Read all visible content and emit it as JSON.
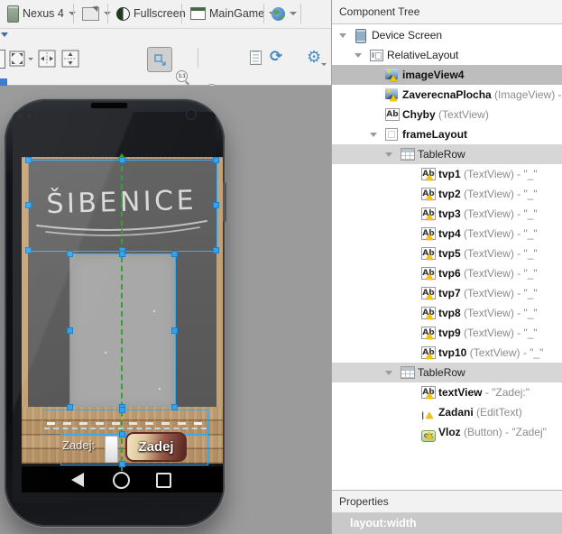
{
  "toolbar": {
    "device_selector": "Nexus 4",
    "fullscreen_label": "Fullscreen",
    "activity_selector": "MainGame",
    "zoom_actual_label": "1:1"
  },
  "icons": {
    "textview_glyph": "Ab",
    "button_glyph": "OK",
    "edittext_glyph": "I",
    "refresh_glyph": "⟳",
    "gear_glyph": "⚙"
  },
  "component_tree": {
    "title": "Component Tree",
    "rows": [
      {
        "label": "Device Screen",
        "level": 1,
        "icon": "device",
        "arrow": true
      },
      {
        "label": "RelativeLayout",
        "level": 2,
        "icon": "layout",
        "arrow": true
      },
      {
        "label": "imageView4",
        "level": 3,
        "icon": "image",
        "warn": true,
        "bold": true,
        "selected": true
      },
      {
        "label": "ZaverecnaPlocha",
        "type": "(ImageView)",
        "value": "-",
        "level": 3,
        "icon": "image",
        "warn": true,
        "bold": true
      },
      {
        "label": "Chyby",
        "type": "(TextView)",
        "level": 3,
        "icon": "text",
        "bold": true
      },
      {
        "label": "frameLayout",
        "level": 3,
        "icon": "frame",
        "arrow": true,
        "bold": true
      },
      {
        "label": "TableRow",
        "level": 4,
        "icon": "table",
        "arrow": true,
        "band": true
      },
      {
        "label": "tvp1",
        "type": "(TextView)",
        "value": "- \"_\"",
        "level": 5,
        "icon": "text",
        "warn": true,
        "bold": true
      },
      {
        "label": "tvp2",
        "type": "(TextView)",
        "value": "- \"_\"",
        "level": 5,
        "icon": "text",
        "warn": true,
        "bold": true
      },
      {
        "label": "tvp3",
        "type": "(TextView)",
        "value": "- \"_\"",
        "level": 5,
        "icon": "text",
        "warn": true,
        "bold": true
      },
      {
        "label": "tvp4",
        "type": "(TextView)",
        "value": "- \"_\"",
        "level": 5,
        "icon": "text",
        "warn": true,
        "bold": true
      },
      {
        "label": "tvp5",
        "type": "(TextView)",
        "value": "- \"_\"",
        "level": 5,
        "icon": "text",
        "warn": true,
        "bold": true
      },
      {
        "label": "tvp6",
        "type": "(TextView)",
        "value": "- \"_\"",
        "level": 5,
        "icon": "text",
        "warn": true,
        "bold": true
      },
      {
        "label": "tvp7",
        "type": "(TextView)",
        "value": "- \"_\"",
        "level": 5,
        "icon": "text",
        "warn": true,
        "bold": true
      },
      {
        "label": "tvp8",
        "type": "(TextView)",
        "value": "- \"_\"",
        "level": 5,
        "icon": "text",
        "warn": true,
        "bold": true
      },
      {
        "label": "tvp9",
        "type": "(TextView)",
        "value": "- \"_\"",
        "level": 5,
        "icon": "text",
        "warn": true,
        "bold": true
      },
      {
        "label": "tvp10",
        "type": "(TextView)",
        "value": "- \"_\"",
        "level": 5,
        "icon": "text",
        "warn": true,
        "bold": true
      },
      {
        "label": "TableRow",
        "level": 4,
        "icon": "table",
        "arrow": true,
        "band": true
      },
      {
        "label": "textView",
        "value": "- \"Zadej:\"",
        "level": 5,
        "icon": "text",
        "warn": true,
        "bold": true
      },
      {
        "label": "Zadani",
        "type": "(EditText)",
        "level": 5,
        "icon": "edittext",
        "warn": true,
        "bold": true
      },
      {
        "label": "Vloz",
        "type": "(Button)",
        "value": "- \"Zadej\"",
        "level": 5,
        "icon": "button",
        "warn": true,
        "bold": true
      }
    ]
  },
  "properties": {
    "title": "Properties",
    "selected_property": "layout:width"
  },
  "phone": {
    "game_title": "ŠIBENICE",
    "underscore_count": 10,
    "input_label": "Zadej:",
    "submit_button": "Zadej"
  },
  "colors": {
    "selection_blue": "#3fa9e8",
    "guide_green": "#2fa32f",
    "warning_yellow": "#f6c500",
    "wood_tan": "#c2a178",
    "chalkboard_gray": "#5d5d5d",
    "canvas_gray": "#9b9b9b"
  }
}
